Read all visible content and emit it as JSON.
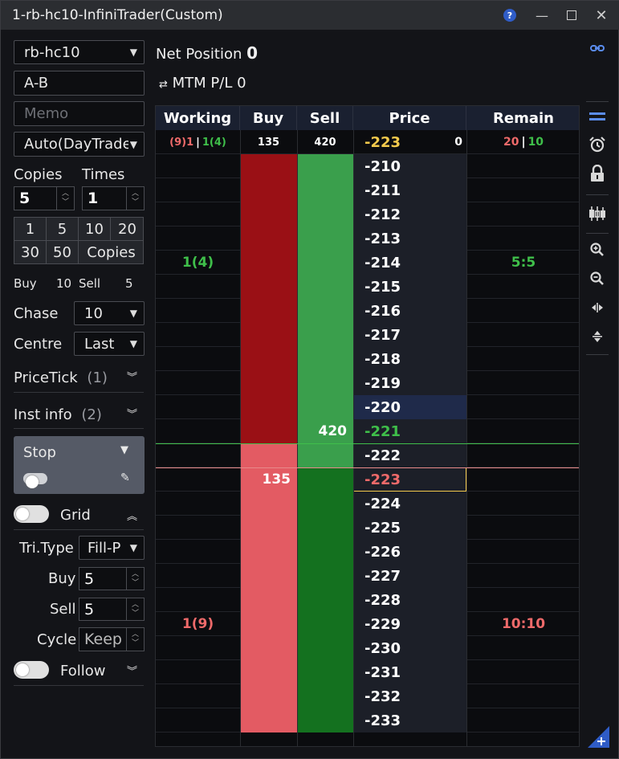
{
  "window": {
    "title": "1-rb-hc10-InfiniTrader(Custom)",
    "help": "?"
  },
  "left": {
    "instrument": "rb-hc10",
    "spread_expr": "A-B",
    "memo_placeholder": "Memo",
    "mode": "Auto(DayTrade",
    "copies_label": "Copies",
    "times_label": "Times",
    "copies_value": "5",
    "times_value": "1",
    "quick": [
      "1",
      "5",
      "10",
      "20",
      "30",
      "50",
      "Copies"
    ],
    "buy_label": "Buy",
    "buy_value": "10",
    "sell_label": "Sell",
    "sell_value": "5",
    "chase_label": "Chase",
    "chase_value": "10",
    "centre_label": "Centre",
    "centre_value": "Last",
    "pricetick_label": "PriceTick",
    "pricetick_count": "(1)",
    "instinfo_label": "Inst info",
    "instinfo_count": "(2)",
    "stop_label": "Stop",
    "grid_label": "Grid",
    "tritype_label": "Tri.Type",
    "tritype_value": "Fill-P",
    "grid_buy_label": "Buy",
    "grid_buy_value": "5",
    "grid_sell_label": "Sell",
    "grid_sell_value": "5",
    "cycle_label": "Cycle",
    "cycle_value": "Keep",
    "follow_label": "Follow"
  },
  "header": {
    "net_position_label": "Net Position",
    "net_position_value": "0",
    "mtm_label": "MTM P/L 0"
  },
  "ladder": {
    "columns": [
      "Working",
      "Buy",
      "Sell",
      "Price",
      "Remain"
    ],
    "summary": {
      "working_red": "(9)1",
      "working_sep": "|",
      "working_green": "1(4)",
      "buy": "135",
      "sell": "420",
      "price": "-223",
      "price_qty": "0",
      "remain_red": "20",
      "remain_sep": "|",
      "remain_green": "10"
    },
    "prices": [
      "-210",
      "-211",
      "-212",
      "-213",
      "-214",
      "-215",
      "-216",
      "-217",
      "-218",
      "-219",
      "-220",
      "-221",
      "-222",
      "-223",
      "-224",
      "-225",
      "-226",
      "-227",
      "-228",
      "-229",
      "-230",
      "-231",
      "-232",
      "-233"
    ],
    "working_sell_row": {
      "price": "-214",
      "text": "1(4)"
    },
    "working_buy_row": {
      "price": "-229",
      "text": "1(9)"
    },
    "remain_sell_row": {
      "price": "-214",
      "text": "5:5"
    },
    "remain_buy_row": {
      "price": "-229",
      "text": "10:10"
    },
    "best_ask": {
      "price": "-221",
      "qty": "420"
    },
    "best_bid": {
      "price": "-223",
      "qty": "135"
    },
    "highlight_price": "-220",
    "colors": {
      "buy_dark": "#9a1015",
      "buy_light": "#e35b63",
      "sell_light": "#3a9f4c",
      "sell_dark": "#14711f",
      "green_text": "#3fbf4a",
      "red_text": "#ef6a6a",
      "yellow": "#f2c94c"
    }
  },
  "toolbar_icons": [
    "link-icon",
    "collapse-icon",
    "alarm-icon",
    "lock-icon",
    "candlestick-icon",
    "zoom-in-icon",
    "zoom-out-icon",
    "horizontal-split-icon",
    "vertical-split-icon",
    "add-corner-icon"
  ]
}
